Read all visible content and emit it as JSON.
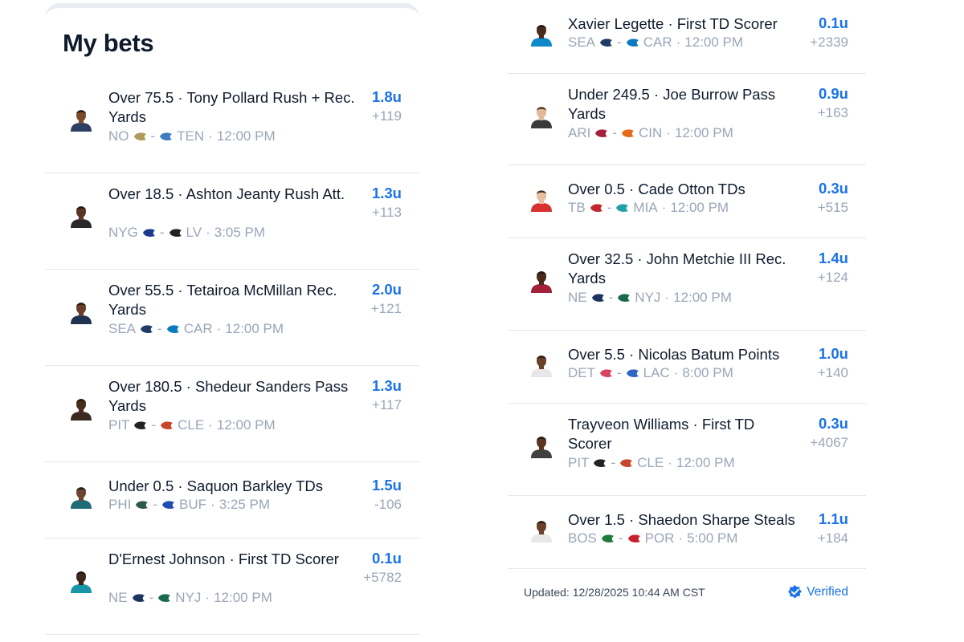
{
  "page_title": "My bets",
  "left_bets": [
    {
      "title": "Over 75.5 · Tony Pollard Rush + Rec. Yards",
      "away": "NO",
      "home": "TEN",
      "time": "12:00 PM",
      "units": "1.8u",
      "odds": "+119",
      "away_color": "#b09a5a",
      "home_color": "#3f7cc0",
      "skin": "#7a4a2c",
      "jersey": "#2b3e63"
    },
    {
      "title": "Over 18.5 · Ashton Jeanty Rush Att.",
      "away": "NYG",
      "home": "LV",
      "time": "3:05 PM",
      "units": "1.3u",
      "odds": "+113",
      "away_color": "#1b3a8c",
      "home_color": "#222222",
      "skin": "#5b3521",
      "jersey": "#2a2a2a"
    },
    {
      "title": "Over 55.5 · Tetairoa McMillan Rec. Yards",
      "away": "SEA",
      "home": "CAR",
      "time": "12:00 PM",
      "units": "2.0u",
      "odds": "+121",
      "away_color": "#1f3b66",
      "home_color": "#0c7ac0",
      "skin": "#6a4028",
      "jersey": "#1f3350"
    },
    {
      "title": "Over 180.5 · Shedeur Sanders Pass Yards",
      "away": "PIT",
      "home": "CLE",
      "time": "12:00 PM",
      "units": "1.3u",
      "odds": "+117",
      "away_color": "#222222",
      "home_color": "#c8452a",
      "skin": "#4a2c1c",
      "jersey": "#3a2a20"
    },
    {
      "title": "Under 0.5 · Saquon Barkley TDs",
      "away": "PHI",
      "home": "BUF",
      "time": "3:25 PM",
      "units": "1.5u",
      "odds": "-106",
      "away_color": "#2e5a4c",
      "home_color": "#1f4bb3",
      "skin": "#6e4530",
      "jersey": "#1f6b76"
    },
    {
      "title": "D'Ernest Johnson · First TD Scorer",
      "away": "NE",
      "home": "NYJ",
      "time": "12:00 PM",
      "units": "0.1u",
      "odds": "+5782",
      "away_color": "#1d3461",
      "home_color": "#1a6b4b",
      "skin": "#3e2618",
      "jersey": "#1796a8"
    }
  ],
  "right_bets": [
    {
      "title": "Xavier Legette · First TD Scorer",
      "away": "SEA",
      "home": "CAR",
      "time": "12:00 PM",
      "units": "0.1u",
      "odds": "+2339",
      "away_color": "#1f3b66",
      "home_color": "#0c7ac0",
      "skin": "#4a2c1c",
      "jersey": "#0d88c9"
    },
    {
      "title": "Under 249.5 · Joe Burrow Pass Yards",
      "away": "ARI",
      "home": "CIN",
      "time": "12:00 PM",
      "units": "0.9u",
      "odds": "+163",
      "away_color": "#a3223b",
      "home_color": "#e56a19",
      "skin": "#e2b896",
      "jersey": "#3a3a3a"
    },
    {
      "title": "Over 0.5 · Cade Otton TDs",
      "away": "TB",
      "home": "MIA",
      "time": "12:00 PM",
      "units": "0.3u",
      "odds": "+515",
      "away_color": "#c2272d",
      "home_color": "#24a0a6",
      "skin": "#e8bf9f",
      "jersey": "#d7322f"
    },
    {
      "title": "Over 32.5 · John Metchie III Rec. Yards",
      "away": "NE",
      "home": "NYJ",
      "time": "12:00 PM",
      "units": "1.4u",
      "odds": "+124",
      "away_color": "#1d3461",
      "home_color": "#1a6b4b",
      "skin": "#4b2a1c",
      "jersey": "#a3223b"
    },
    {
      "title": "Over 5.5 · Nicolas Batum Points",
      "away": "DET",
      "home": "LAC",
      "time": "8:00 PM",
      "units": "1.0u",
      "odds": "+140",
      "away_color": "#d8435f",
      "home_color": "#2e66c8",
      "skin": "#6a4028",
      "jersey": "#e7e7e7"
    },
    {
      "title": "Trayveon Williams · First TD Scorer",
      "away": "PIT",
      "home": "CLE",
      "time": "12:00 PM",
      "units": "0.3u",
      "odds": "+4067",
      "away_color": "#222222",
      "home_color": "#c8452a",
      "skin": "#5b3521",
      "jersey": "#404040"
    },
    {
      "title": "Over 1.5 · Shaedon Sharpe Steals",
      "away": "BOS",
      "home": "POR",
      "time": "5:00 PM",
      "units": "1.1u",
      "odds": "+184",
      "away_color": "#1f7a3c",
      "home_color": "#c8202f",
      "skin": "#6a4028",
      "jersey": "#e8e8e8"
    }
  ],
  "footer": {
    "updated": "Updated: 12/28/2025 10:44 AM CST",
    "verified": "Verified"
  },
  "colors": {
    "accent": "#1a73e8",
    "muted": "#9aa6b8",
    "text": "#0f1b2d",
    "divider": "#e3e7ee"
  }
}
